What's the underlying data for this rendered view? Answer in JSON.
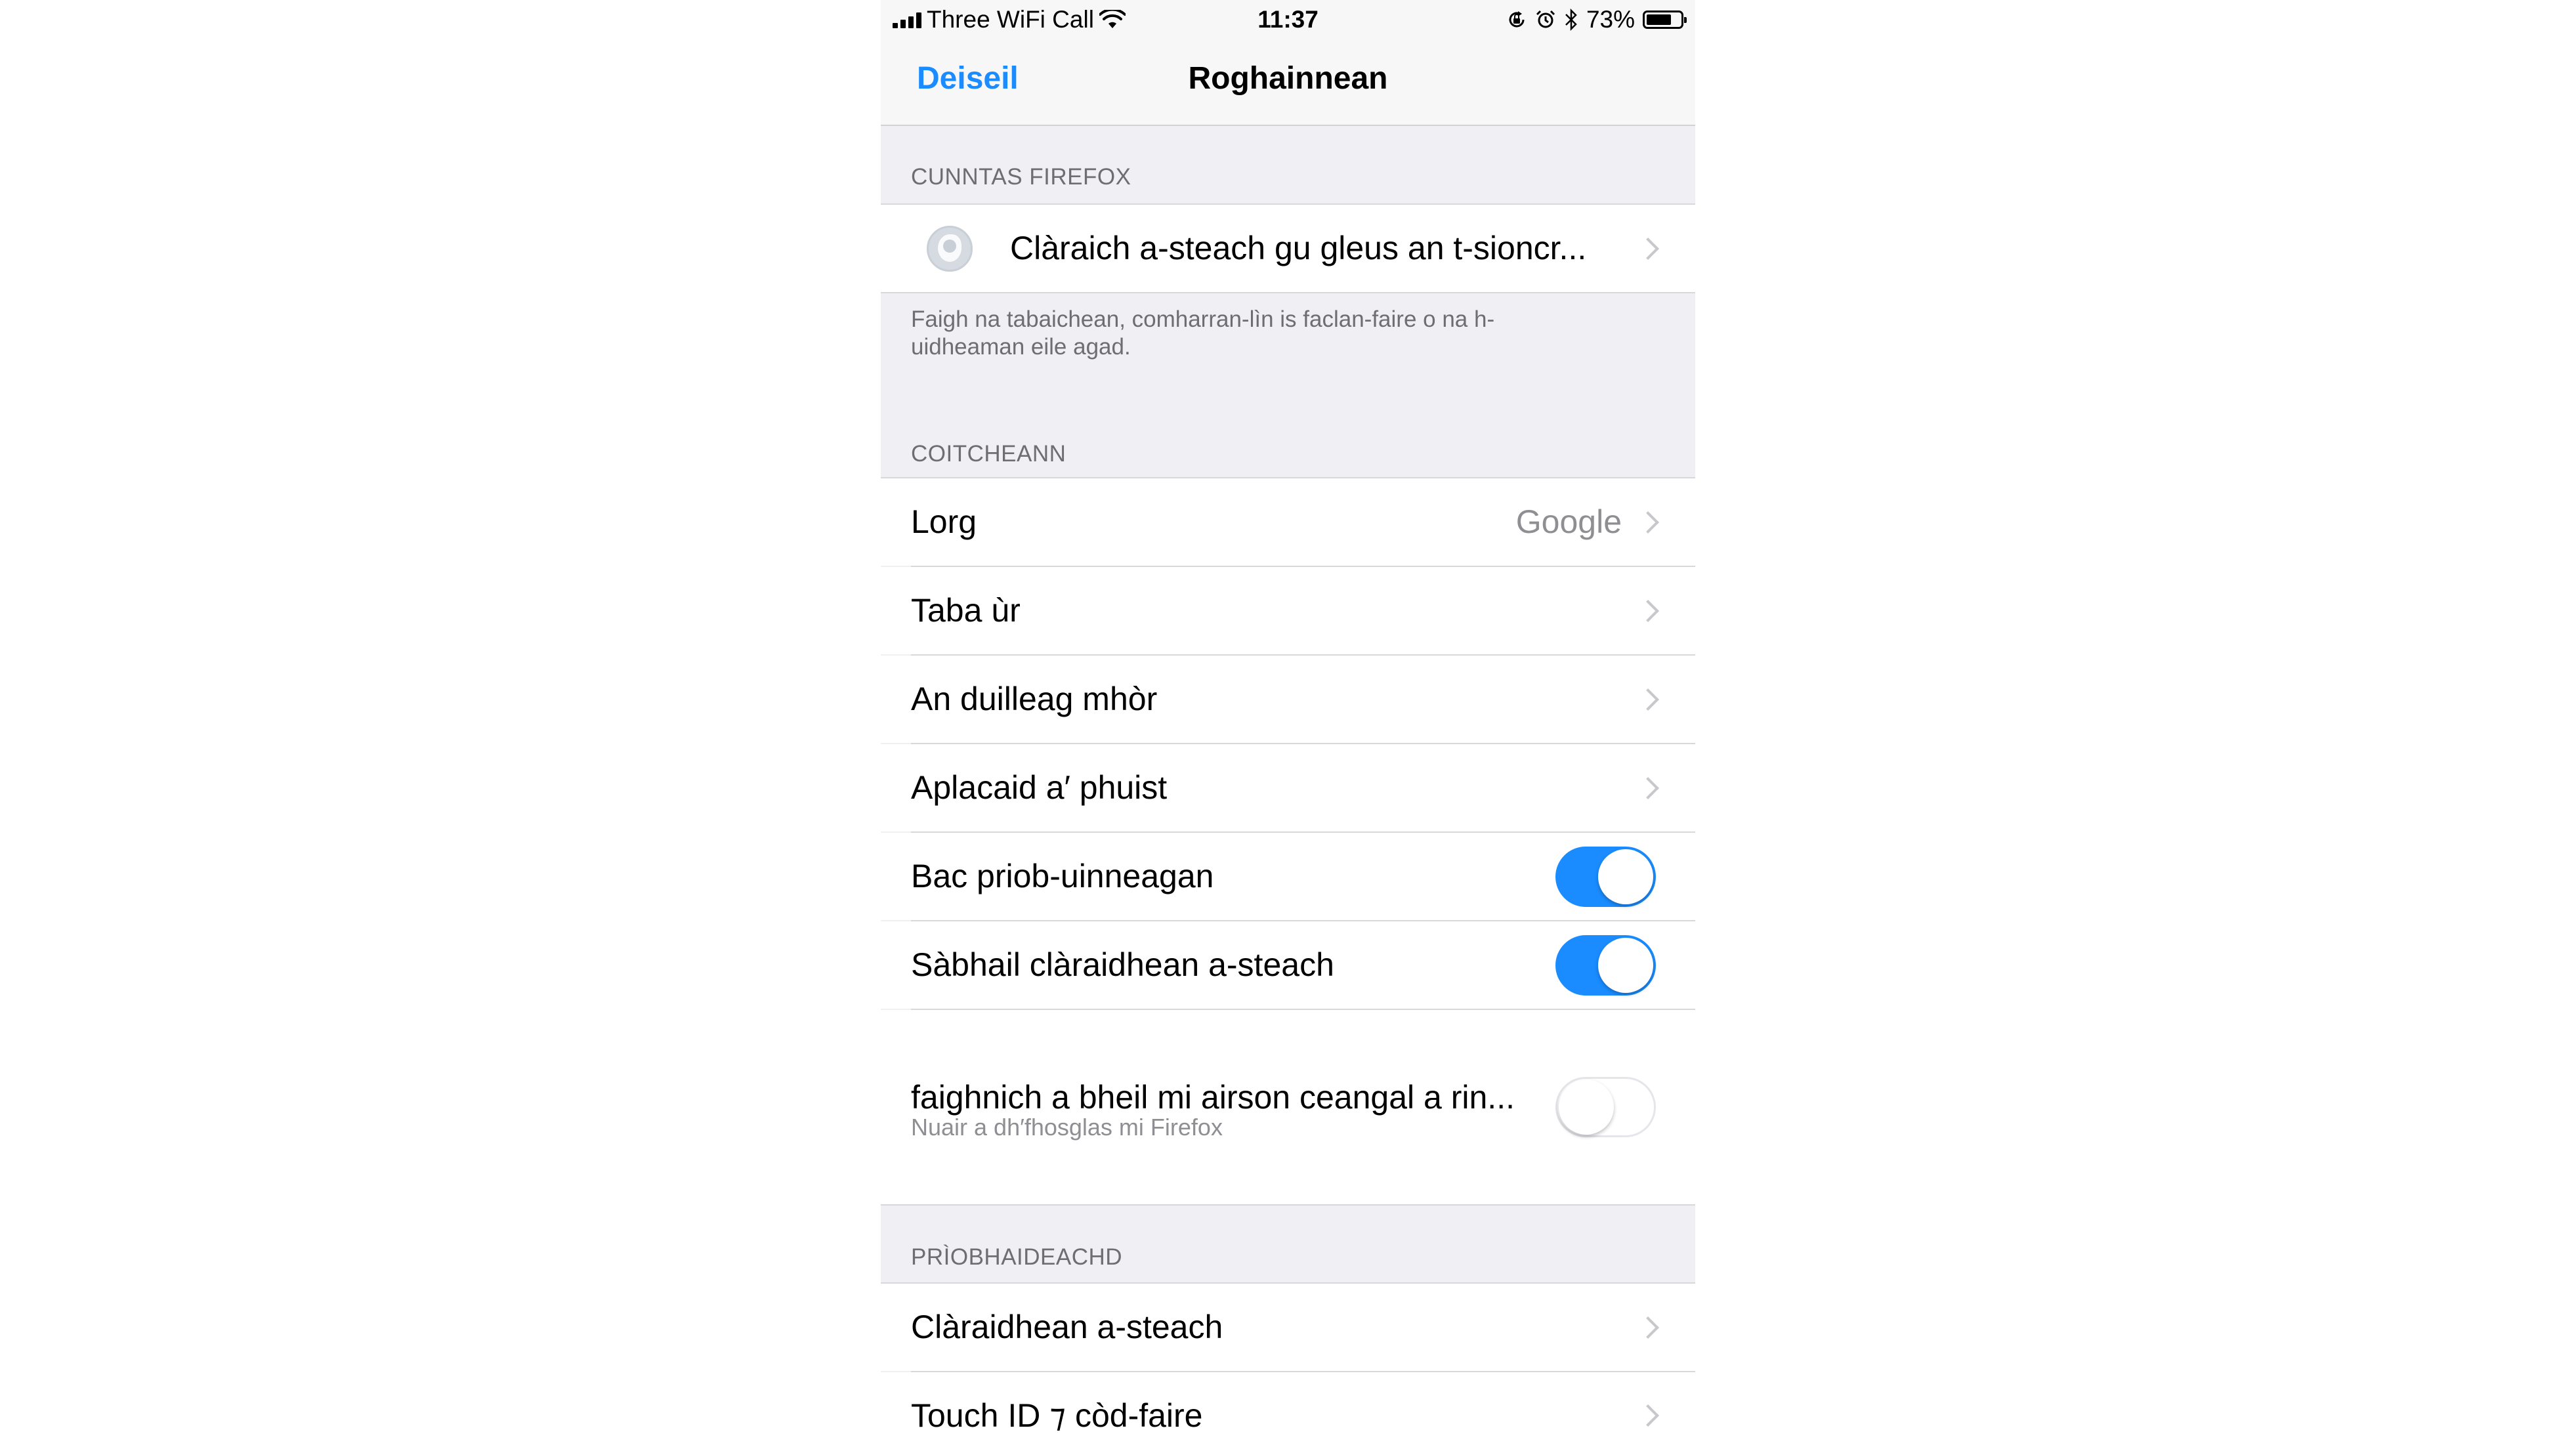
{
  "status_bar": {
    "carrier": "Three WiFi Call",
    "time": "11:37",
    "battery_percent": "73%",
    "battery_level": 0.73,
    "icons": [
      "signal-icon",
      "wifi-icon",
      "orientation-lock-icon",
      "alarm-icon",
      "bluetooth-icon",
      "battery-icon"
    ]
  },
  "nav": {
    "done_label": "Deiseil",
    "title": "Roghainnean"
  },
  "firefox_account": {
    "header": "CUNNTAS FIREFOX",
    "sign_in_label": "Clàraich a-steach gu gleus an t-sioncr...",
    "footer": "Faigh na tabaichean, comharran-lìn is faclan-faire o na h-uidheaman eile agad."
  },
  "general": {
    "header": "COITCHEANN",
    "rows": [
      {
        "label": "Lorg",
        "value": "Google"
      },
      {
        "label": "Taba ùr",
        "value": ""
      },
      {
        "label": "An duilleag mhòr",
        "value": ""
      },
      {
        "label": "Aplacaid a′ phuist",
        "value": ""
      }
    ],
    "toggles": [
      {
        "label": "Bac priob-uinneagan",
        "on": true
      },
      {
        "label": "Sàbhail clàraidhean a-steach",
        "on": true
      }
    ],
    "link_check": {
      "label": "faighnich a bheil mi airson ceangal a rin...",
      "sublabel": "Nuair a dh′fhosglas mi Firefox",
      "on": false
    }
  },
  "privacy": {
    "header": "PRÌOBHAIDEACHD",
    "rows": [
      {
        "label": "Clàraidhean a-steach"
      },
      {
        "label": "Touch ID ⁊ còd-faire"
      }
    ]
  },
  "colors": {
    "accent": "#1a8cff",
    "grouped_background": "#efeff4",
    "secondary_text": "#8e8e93"
  }
}
